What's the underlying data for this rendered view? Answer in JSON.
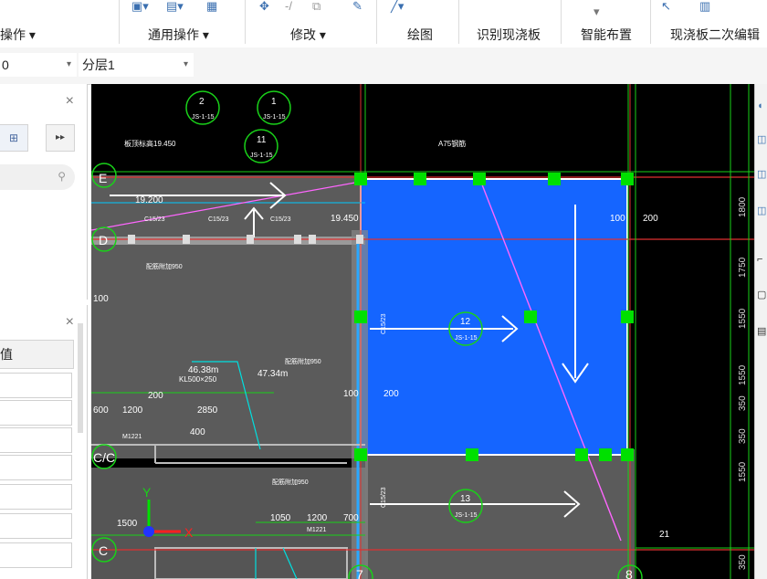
{
  "ribbon": {
    "groups": [
      {
        "label": "操作 ▾"
      },
      {
        "label": "通用操作 ▾"
      },
      {
        "label": "修改 ▾"
      },
      {
        "label": "绘图"
      },
      {
        "label": "识别现浇板"
      },
      {
        "label": "智能布置"
      },
      {
        "label": "现浇板二次编辑"
      }
    ],
    "icons": [
      "floor-icon",
      "layer-icon",
      "grid-icon",
      "move-icon",
      "trim-icon",
      "copy-icon",
      "edit-icon",
      "line-icon",
      "dropdown-icon",
      "pick-icon",
      "batch-icon"
    ]
  },
  "toolbar2": {
    "floor_value": "0",
    "layer_value": "分层1"
  },
  "panel1": {
    "close": "×"
  },
  "panel2": {
    "close": "×",
    "header": "值"
  },
  "drawing": {
    "axis_labels": [
      "E",
      "D",
      "C/C",
      "C",
      "7",
      "8",
      "2",
      "1",
      "11",
      "12",
      "13"
    ],
    "callout_sub": "JS-1-15",
    "texts": {
      "elev1": "19.200",
      "elev2": "19.450",
      "elev_top": "板顶标高19.450",
      "a75": "A75钢筋",
      "area1": "46.38m",
      "area2": "47.34m",
      "beam": "KL500×250",
      "dim_600": "600",
      "dim_1200": "1200",
      "dim_200": "200",
      "dim_2850": "2850",
      "dim_400": "400",
      "dim_100": "100",
      "dim_200b": "200",
      "dim_1500": "1500",
      "dim_1050": "1050",
      "dim_1200b": "1200",
      "dim_700": "700",
      "dim_100b": "100",
      "dim_200c": "200",
      "dim_21": "21",
      "m1": "M1221",
      "m2": "M1221",
      "cs1": "C15/23",
      "cs2": "C15/23",
      "cs3": "C15/23",
      "cs4": "C15/23",
      "cs5": "C15/23",
      "yaxis": "Y",
      "xaxis": "X",
      "dim1800": "1800",
      "dim1750": "1750",
      "dim1550": "1550",
      "dim1550b": "1550",
      "dim1550c": "1550",
      "dim350": "350",
      "dim350b": "350",
      "dim350c": "350",
      "sbe": "配筋附加950",
      "sbe2": "配筋附加950",
      "sbe3": "配筋附加950"
    }
  },
  "colors": {
    "slab_fill": "#1565ff",
    "grip": "#00e000",
    "slab_grey": "#5b5b5b",
    "axis_red": "#e03030",
    "callout_green": "#19d119",
    "magenta": "#ff66ff"
  }
}
